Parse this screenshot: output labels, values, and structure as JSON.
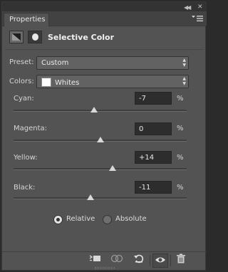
{
  "panel": {
    "tab_label": "Properties",
    "title": "Selective Color"
  },
  "icons": {
    "adjustment": "selective-color-adjustment-icon",
    "mask": "layer-mask-icon",
    "panel_menu": "panel-menu-icon",
    "collapse": "collapse-panel-icon",
    "close": "close-panel-icon",
    "clip": "clip-to-layer-icon",
    "view_previous": "view-previous-state-icon",
    "reset": "reset-icon",
    "visibility": "eye-icon",
    "delete": "trash-icon"
  },
  "preset": {
    "label": "Preset:",
    "value": "Custom"
  },
  "colors": {
    "label": "Colors:",
    "value": "Whites",
    "swatch": "#ffffff"
  },
  "sliders": [
    {
      "label": "Cyan:",
      "value": "-7",
      "unit": "%",
      "level": -7
    },
    {
      "label": "Magenta:",
      "value": "0",
      "unit": "%",
      "level": 0
    },
    {
      "label": "Yellow:",
      "value": "+14",
      "unit": "%",
      "level": 14
    },
    {
      "label": "Black:",
      "value": "-11",
      "unit": "%",
      "level": -11
    }
  ],
  "method": {
    "options": [
      {
        "label": "Relative",
        "selected": true
      },
      {
        "label": "Absolute",
        "selected": false
      }
    ]
  },
  "colors_theme": {
    "panel": "#535353",
    "field": "#2d2d2d",
    "thumb": "#d8d8d8"
  }
}
